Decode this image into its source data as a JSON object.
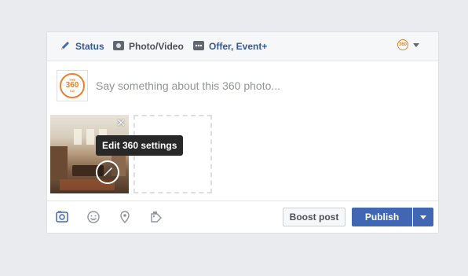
{
  "tabs": {
    "status": {
      "label": "Status",
      "icon": "pencil-icon"
    },
    "photo_video": {
      "label": "Photo/Video",
      "icon": "camera-icon"
    },
    "offer_event": {
      "label": "Offer, Event+",
      "icon": "more-icon"
    }
  },
  "page_logo": {
    "line1": "THE",
    "line2": "360",
    "line3": "CO"
  },
  "composer": {
    "placeholder": "Say something about this 360 photo..."
  },
  "attachment": {
    "tooltip": "Edit 360 settings",
    "close_symbol": "✕"
  },
  "footer": {
    "icons": [
      "photo-icon",
      "smiley-icon",
      "location-pin-icon",
      "tag-icon"
    ],
    "boost_label": "Boost post",
    "publish_label": "Publish"
  },
  "colors": {
    "accent": "#4267b2",
    "link": "#365899",
    "brand_orange": "#e8822b",
    "background": "#e9ebee"
  }
}
